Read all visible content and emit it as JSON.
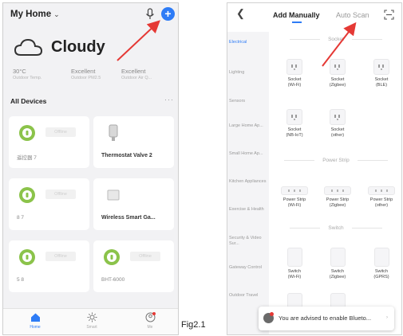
{
  "left_phone": {
    "home_title": "My Home",
    "weather": "Cloudy",
    "stats": [
      {
        "value": "30°C",
        "label": "Outdoor Temp."
      },
      {
        "value": "Excellent",
        "label": "Outdoor PM2.5"
      },
      {
        "value": "Excellent",
        "label": "Outdoor Air Q..."
      }
    ],
    "section_title": "All Devices",
    "offline_label": "Offline",
    "devices": [
      {
        "name": "遥控器 7"
      },
      {
        "name": "Thermostat Valve 2"
      },
      {
        "name": "8 7"
      },
      {
        "name": "Wireless Smart Ga..."
      },
      {
        "name": "5 8"
      },
      {
        "name": "BHT-6000"
      }
    ],
    "nav": [
      {
        "label": "Home"
      },
      {
        "label": "Smart"
      },
      {
        "label": "Me"
      }
    ]
  },
  "right_phone": {
    "tabs": {
      "add_manually": "Add Manually",
      "auto_scan": "Auto Scan"
    },
    "categories": [
      "Electrical",
      "Lighting",
      "Sensors",
      "Large Home Ap...",
      "Small Home Ap...",
      "Kitchen Appliances",
      "Exercise & Health",
      "Security & Video Sur...",
      "Gateway Control",
      "Outdoor Travel"
    ],
    "groups": [
      {
        "title": "Socket",
        "items": [
          {
            "line1": "Socket",
            "line2": "(Wi-Fi)"
          },
          {
            "line1": "Socket",
            "line2": "(Zigbee)"
          },
          {
            "line1": "Socket",
            "line2": "(BLE)"
          },
          {
            "line1": "Socket",
            "line2": "(NB-IoT)"
          },
          {
            "line1": "Socket",
            "line2": "(other)"
          }
        ]
      },
      {
        "title": "Power Strip",
        "items": [
          {
            "line1": "Power Strip",
            "line2": "(Wi-Fi)"
          },
          {
            "line1": "Power Strip",
            "line2": "(Zigbee)"
          },
          {
            "line1": "Power Strip",
            "line2": "(other)"
          }
        ]
      },
      {
        "title": "Switch",
        "items": [
          {
            "line1": "Switch",
            "line2": "(Wi-Fi)"
          },
          {
            "line1": "Switch",
            "line2": "(Zigbee)"
          },
          {
            "line1": "Switch",
            "line2": "(GPRS)"
          }
        ]
      }
    ],
    "toast": "You are advised to enable Blueto..."
  },
  "caption": "Fig2.1",
  "colors": {
    "accent": "#2e7cf6",
    "annotation_arrow": "#e53935",
    "device_icon": "#8bc34a"
  }
}
